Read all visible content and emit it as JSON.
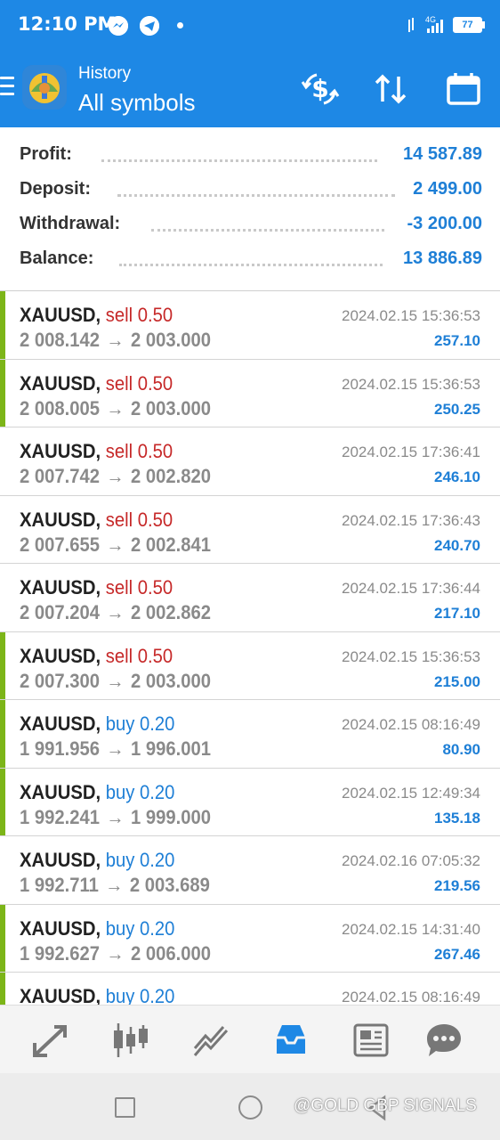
{
  "status_bar": {
    "time": "12:10 PM",
    "network": "4G",
    "battery": "77",
    "icons": [
      "messenger-icon",
      "telegram-icon",
      "notification-dot",
      "signal-icon",
      "battery-icon"
    ]
  },
  "app_bar": {
    "title_small": "History",
    "title_big": "All symbols",
    "actions": [
      "deposit-withdraw-icon",
      "sort-icon",
      "calendar-icon"
    ]
  },
  "summary": {
    "profit_label": "Profit:",
    "profit_value": "14 587.89",
    "deposit_label": "Deposit:",
    "deposit_value": "2 499.00",
    "withdrawal_label": "Withdrawal:",
    "withdrawal_value": "-3 200.00",
    "balance_label": "Balance:",
    "balance_value": "13 886.89"
  },
  "deals": [
    {
      "symbol": "XAUUSD,",
      "type": "sell",
      "volume": "0.50",
      "open": "2 008.142",
      "close": "2 003.000",
      "time": "2024.02.15 15:36:53",
      "profit": "257.10",
      "bar": true
    },
    {
      "symbol": "XAUUSD,",
      "type": "sell",
      "volume": "0.50",
      "open": "2 008.005",
      "close": "2 003.000",
      "time": "2024.02.15 15:36:53",
      "profit": "250.25",
      "bar": true
    },
    {
      "symbol": "XAUUSD,",
      "type": "sell",
      "volume": "0.50",
      "open": "2 007.742",
      "close": "2 002.820",
      "time": "2024.02.15 17:36:41",
      "profit": "246.10",
      "bar": false
    },
    {
      "symbol": "XAUUSD,",
      "type": "sell",
      "volume": "0.50",
      "open": "2 007.655",
      "close": "2 002.841",
      "time": "2024.02.15 17:36:43",
      "profit": "240.70",
      "bar": false
    },
    {
      "symbol": "XAUUSD,",
      "type": "sell",
      "volume": "0.50",
      "open": "2 007.204",
      "close": "2 002.862",
      "time": "2024.02.15 17:36:44",
      "profit": "217.10",
      "bar": false
    },
    {
      "symbol": "XAUUSD,",
      "type": "sell",
      "volume": "0.50",
      "open": "2 007.300",
      "close": "2 003.000",
      "time": "2024.02.15 15:36:53",
      "profit": "215.00",
      "bar": true
    },
    {
      "symbol": "XAUUSD,",
      "type": "buy",
      "volume": "0.20",
      "open": "1 991.956",
      "close": "1 996.001",
      "time": "2024.02.15 08:16:49",
      "profit": "80.90",
      "bar": true
    },
    {
      "symbol": "XAUUSD,",
      "type": "buy",
      "volume": "0.20",
      "open": "1 992.241",
      "close": "1 999.000",
      "time": "2024.02.15 12:49:34",
      "profit": "135.18",
      "bar": true
    },
    {
      "symbol": "XAUUSD,",
      "type": "buy",
      "volume": "0.20",
      "open": "1 992.711",
      "close": "2 003.689",
      "time": "2024.02.16 07:05:32",
      "profit": "219.56",
      "bar": false
    },
    {
      "symbol": "XAUUSD,",
      "type": "buy",
      "volume": "0.20",
      "open": "1 992.627",
      "close": "2 006.000",
      "time": "2024.02.15 14:31:40",
      "profit": "267.46",
      "bar": true
    },
    {
      "symbol": "XAUUSD,",
      "type": "buy",
      "volume": "0.20",
      "open": "",
      "close": "",
      "time": "2024.02.15 08:16:49",
      "profit": "",
      "bar": true
    }
  ],
  "price_separator": "→",
  "bottom_nav": [
    "quotes-icon",
    "chart-icon",
    "trade-icon",
    "history-icon",
    "news-icon",
    "chat-icon"
  ],
  "watermark": "@GOLD GBP SIGNALS",
  "colors": {
    "header_blue": "#1e88e5",
    "value_blue": "#1e7fd6",
    "sell_red": "#c62828",
    "bar_green": "#7cb518"
  }
}
